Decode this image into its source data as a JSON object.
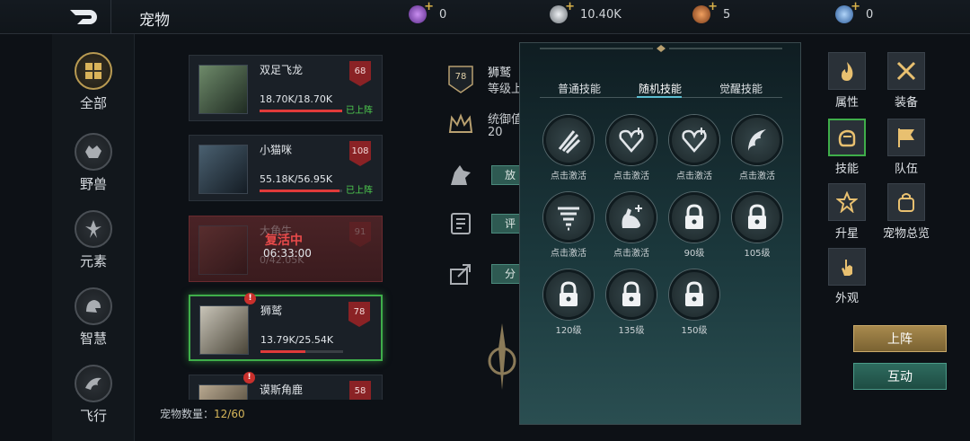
{
  "header": {
    "title": "宠物",
    "currencies": [
      {
        "icon": "purple-gem-icon",
        "value": "0",
        "color": "#9a54c8"
      },
      {
        "icon": "silver-coin-icon",
        "value": "10.40K",
        "color": "#b8bec4"
      },
      {
        "icon": "bronze-medal-icon",
        "value": "5",
        "color": "#d0743a"
      },
      {
        "icon": "blue-orb-icon",
        "value": "0",
        "color": "#5a8ed0"
      }
    ]
  },
  "sidebar": {
    "items": [
      {
        "label": "全部",
        "icon": "grid-icon",
        "active": true
      },
      {
        "label": "野兽",
        "icon": "beast-icon"
      },
      {
        "label": "元素",
        "icon": "element-icon"
      },
      {
        "label": "智慧",
        "icon": "wisdom-icon"
      },
      {
        "label": "飞行",
        "icon": "flying-icon"
      }
    ]
  },
  "pets": [
    {
      "name": "双足飞龙",
      "hp": "18.70K/18.70K",
      "hp_fraction": 1.0,
      "level": "68",
      "status": "已上阵"
    },
    {
      "name": "小猫咪",
      "hp": "55.18K/56.95K",
      "hp_fraction": 0.97,
      "level": "108",
      "status": "已上阵"
    },
    {
      "name": "大角牛",
      "revive_label": "复活中",
      "revive_time": "06:33:00",
      "hp": "0/42.05K",
      "level": "91"
    },
    {
      "name": "狮鹫",
      "hp": "13.79K/25.54K",
      "hp_fraction": 0.54,
      "level": "78",
      "alert": "!"
    },
    {
      "name": "谟斯角鹿",
      "level": "58",
      "alert": "!"
    }
  ],
  "pet_count_label": "宠物数量：",
  "pet_count_value": "12/60",
  "detail": {
    "name": "狮鹫",
    "level_badge": "78",
    "level_label": "等级上",
    "command_label": "统御值",
    "command_value": "20",
    "release_btn": "放",
    "rate_btn": "评",
    "share_btn": "分"
  },
  "skill_panel": {
    "tabs": [
      "普通技能",
      "随机技能",
      "觉醒技能"
    ],
    "active_tab": 1,
    "slots": [
      {
        "label": "点击激活",
        "icon": "claw-slash-icon"
      },
      {
        "label": "点击激活",
        "icon": "heart-plus-icon"
      },
      {
        "label": "点击激活",
        "icon": "heart-plus-icon"
      },
      {
        "label": "点击激活",
        "icon": "wing-icon"
      },
      {
        "label": "点击激活",
        "icon": "tornado-icon"
      },
      {
        "label": "点击激活",
        "icon": "muscle-plus-icon"
      },
      {
        "label": "90级",
        "icon": "lock-icon"
      },
      {
        "label": "105级",
        "icon": "lock-icon"
      },
      {
        "label": "120级",
        "icon": "lock-icon"
      },
      {
        "label": "135级",
        "icon": "lock-icon"
      },
      {
        "label": "150级",
        "icon": "lock-icon"
      }
    ]
  },
  "right_menu": {
    "items": [
      {
        "label": "属性",
        "icon": "flame-icon"
      },
      {
        "label": "装备",
        "icon": "crossed-swords-icon"
      },
      {
        "label": "技能",
        "icon": "fist-icon",
        "selected": true
      },
      {
        "label": "队伍",
        "icon": "flag-icon"
      },
      {
        "label": "升星",
        "icon": "star-icon"
      },
      {
        "label": "宠物总览",
        "icon": "bag-icon"
      },
      {
        "label": "外观",
        "icon": "hand-icon"
      }
    ],
    "deploy_btn": "上阵",
    "interact_btn": "互动"
  }
}
